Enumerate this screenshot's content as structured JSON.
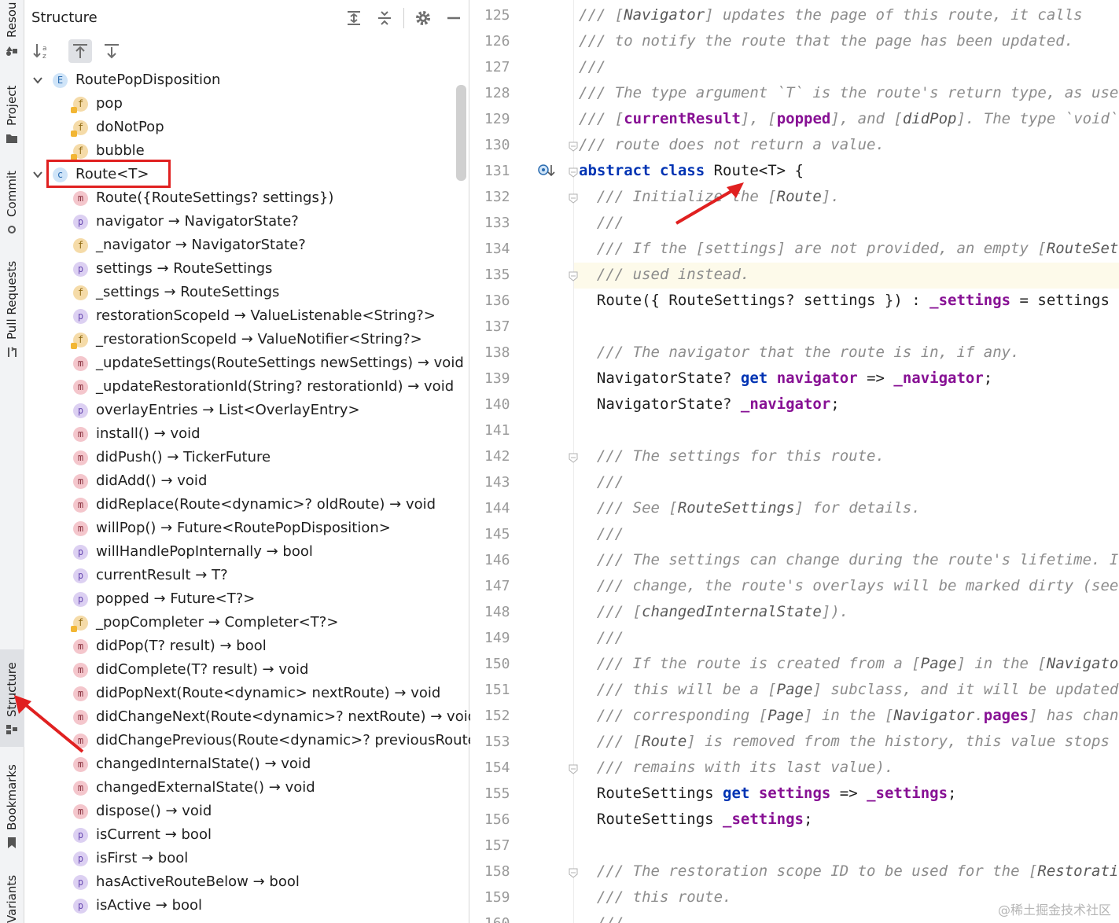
{
  "left_strip": {
    "tabs": [
      {
        "label": "Resou",
        "icon": "resource-manager-icon"
      },
      {
        "label": "Project",
        "icon": "folder-icon"
      },
      {
        "label": "Commit",
        "icon": "commit-icon"
      },
      {
        "label": "Pull Requests",
        "icon": "pull-request-icon"
      },
      {
        "label": "Structure",
        "icon": "structure-icon",
        "active": true
      },
      {
        "label": "Bookmarks",
        "icon": "bookmark-icon"
      },
      {
        "label": "Variants",
        "icon": "variants-icon"
      }
    ]
  },
  "structure": {
    "title": "Structure",
    "header_icons": [
      "expand-all-icon",
      "collapse-all-icon",
      "gear-icon",
      "minimize-icon"
    ],
    "toolbar_icons": [
      "sort-alpha-icon",
      "navigate-to-source-icon",
      "navigate-from-source-icon"
    ],
    "tree": [
      {
        "indent": 0,
        "expanded": true,
        "kind": "E",
        "label": "RoutePopDisposition"
      },
      {
        "indent": 1,
        "kind": "f",
        "lock": true,
        "label": "pop"
      },
      {
        "indent": 1,
        "kind": "f",
        "lock": true,
        "label": "doNotPop"
      },
      {
        "indent": 1,
        "kind": "f",
        "lock": true,
        "label": "bubble"
      },
      {
        "indent": 0,
        "expanded": true,
        "kind": "C",
        "label": "Route<T>"
      },
      {
        "indent": 1,
        "kind": "m",
        "label": "Route({RouteSettings? settings})"
      },
      {
        "indent": 1,
        "kind": "p",
        "label": "navigator → NavigatorState?"
      },
      {
        "indent": 1,
        "kind": "f",
        "label": "_navigator → NavigatorState?"
      },
      {
        "indent": 1,
        "kind": "p",
        "label": "settings → RouteSettings"
      },
      {
        "indent": 1,
        "kind": "f",
        "label": "_settings → RouteSettings"
      },
      {
        "indent": 1,
        "kind": "p",
        "label": "restorationScopeId → ValueListenable<String?>"
      },
      {
        "indent": 1,
        "kind": "f",
        "lock": true,
        "label": "_restorationScopeId → ValueNotifier<String?>"
      },
      {
        "indent": 1,
        "kind": "m",
        "label": "_updateSettings(RouteSettings newSettings) → void"
      },
      {
        "indent": 1,
        "kind": "m",
        "label": "_updateRestorationId(String? restorationId) → void"
      },
      {
        "indent": 1,
        "kind": "p",
        "label": "overlayEntries → List<OverlayEntry>"
      },
      {
        "indent": 1,
        "kind": "m",
        "label": "install() → void"
      },
      {
        "indent": 1,
        "kind": "m",
        "label": "didPush() → TickerFuture"
      },
      {
        "indent": 1,
        "kind": "m",
        "label": "didAdd() → void"
      },
      {
        "indent": 1,
        "kind": "m",
        "label": "didReplace(Route<dynamic>? oldRoute) → void"
      },
      {
        "indent": 1,
        "kind": "m",
        "label": "willPop() → Future<RoutePopDisposition>"
      },
      {
        "indent": 1,
        "kind": "p",
        "label": "willHandlePopInternally → bool"
      },
      {
        "indent": 1,
        "kind": "p",
        "label": "currentResult → T?"
      },
      {
        "indent": 1,
        "kind": "p",
        "label": "popped → Future<T?>"
      },
      {
        "indent": 1,
        "kind": "f",
        "lock": true,
        "label": "_popCompleter → Completer<T?>"
      },
      {
        "indent": 1,
        "kind": "m",
        "label": "didPop(T? result) → bool"
      },
      {
        "indent": 1,
        "kind": "m",
        "label": "didComplete(T? result) → void"
      },
      {
        "indent": 1,
        "kind": "m",
        "label": "didPopNext(Route<dynamic> nextRoute) → void"
      },
      {
        "indent": 1,
        "kind": "m",
        "label": "didChangeNext(Route<dynamic>? nextRoute) → void"
      },
      {
        "indent": 1,
        "kind": "m",
        "label": "didChangePrevious(Route<dynamic>? previousRoute) → void"
      },
      {
        "indent": 1,
        "kind": "m",
        "label": "changedInternalState() → void"
      },
      {
        "indent": 1,
        "kind": "m",
        "label": "changedExternalState() → void"
      },
      {
        "indent": 1,
        "kind": "m",
        "label": "dispose() → void"
      },
      {
        "indent": 1,
        "kind": "p",
        "label": "isCurrent → bool"
      },
      {
        "indent": 1,
        "kind": "p",
        "label": "isFirst → bool"
      },
      {
        "indent": 1,
        "kind": "p",
        "label": "hasActiveRouteBelow → bool"
      },
      {
        "indent": 1,
        "kind": "p",
        "label": "isActive → bool"
      }
    ]
  },
  "editor": {
    "current_line": 135,
    "lines": [
      {
        "n": "125",
        "fold": false,
        "tokens": [
          [
            "cm",
            "/// ["
          ],
          [
            "ref",
            "Navigator"
          ],
          [
            "cm",
            "] updates the page of this route, it calls"
          ]
        ]
      },
      {
        "n": "126",
        "tokens": [
          [
            "cm",
            "/// to notify the route that the page has been updated."
          ]
        ]
      },
      {
        "n": "127",
        "tokens": [
          [
            "cm",
            "///"
          ]
        ]
      },
      {
        "n": "128",
        "tokens": [
          [
            "cm",
            "/// The type argument `T` is the route's return type, as used by"
          ]
        ]
      },
      {
        "n": "129",
        "tokens": [
          [
            "cm",
            "/// ["
          ],
          [
            "fld",
            "currentResult"
          ],
          [
            "cm",
            "], ["
          ],
          [
            "fld",
            "popped"
          ],
          [
            "cm",
            "], and ["
          ],
          [
            "ref",
            "didPop"
          ],
          [
            "cm",
            "]. The type `void` may be used if the"
          ]
        ]
      },
      {
        "n": "130",
        "fold": true,
        "tokens": [
          [
            "cm",
            "/// route does not return a value."
          ]
        ]
      },
      {
        "n": "131",
        "fold": true,
        "marker": true,
        "tokens": [
          [
            "kw",
            "abstract"
          ],
          [
            "pl",
            " "
          ],
          [
            "kw",
            "class"
          ],
          [
            "pl",
            " Route<T> {"
          ]
        ]
      },
      {
        "n": "132",
        "fold": true,
        "tokens": [
          [
            "pl",
            "  "
          ],
          [
            "cm",
            "/// Initialize the ["
          ],
          [
            "ref",
            "Route"
          ],
          [
            "cm",
            "]."
          ]
        ]
      },
      {
        "n": "133",
        "tokens": [
          [
            "pl",
            "  "
          ],
          [
            "cm",
            "///"
          ]
        ]
      },
      {
        "n": "134",
        "tokens": [
          [
            "pl",
            "  "
          ],
          [
            "cm",
            "/// If the [settings] are not provided, an empty ["
          ],
          [
            "ref",
            "RouteSettings"
          ],
          [
            "cm",
            "] object is"
          ]
        ]
      },
      {
        "n": "135",
        "fold": true,
        "tokens": [
          [
            "pl",
            "  "
          ],
          [
            "cm",
            "/// used instead."
          ]
        ]
      },
      {
        "n": "136",
        "tokens": [
          [
            "pl",
            "  Route({ RouteSettings? settings }) : "
          ],
          [
            "fld",
            "_settings"
          ],
          [
            "pl",
            " = settings ?? const RouteSettings();"
          ]
        ]
      },
      {
        "n": "137",
        "tokens": []
      },
      {
        "n": "138",
        "tokens": [
          [
            "pl",
            "  "
          ],
          [
            "cm",
            "/// The navigator that the route is in, if any."
          ]
        ]
      },
      {
        "n": "139",
        "tokens": [
          [
            "pl",
            "  NavigatorState? "
          ],
          [
            "kw",
            "get"
          ],
          [
            "pl",
            " "
          ],
          [
            "fld",
            "navigator"
          ],
          [
            "pl",
            " => "
          ],
          [
            "fld",
            "_navigator"
          ],
          [
            "pl",
            ";"
          ]
        ]
      },
      {
        "n": "140",
        "tokens": [
          [
            "pl",
            "  NavigatorState? "
          ],
          [
            "fld",
            "_navigator"
          ],
          [
            "pl",
            ";"
          ]
        ]
      },
      {
        "n": "141",
        "tokens": []
      },
      {
        "n": "142",
        "fold": true,
        "tokens": [
          [
            "pl",
            "  "
          ],
          [
            "cm",
            "/// The settings for this route."
          ]
        ]
      },
      {
        "n": "143",
        "tokens": [
          [
            "pl",
            "  "
          ],
          [
            "cm",
            "///"
          ]
        ]
      },
      {
        "n": "144",
        "tokens": [
          [
            "pl",
            "  "
          ],
          [
            "cm",
            "/// See ["
          ],
          [
            "ref",
            "RouteSettings"
          ],
          [
            "cm",
            "] for details."
          ]
        ]
      },
      {
        "n": "145",
        "tokens": [
          [
            "pl",
            "  "
          ],
          [
            "cm",
            "///"
          ]
        ]
      },
      {
        "n": "146",
        "tokens": [
          [
            "pl",
            "  "
          ],
          [
            "cm",
            "/// The settings can change during the route's lifetime. If the settings"
          ]
        ]
      },
      {
        "n": "147",
        "tokens": [
          [
            "pl",
            "  "
          ],
          [
            "cm",
            "/// change, the route's overlays will be marked dirty (see"
          ]
        ]
      },
      {
        "n": "148",
        "tokens": [
          [
            "pl",
            "  "
          ],
          [
            "cm",
            "/// ["
          ],
          [
            "ref",
            "changedInternalState"
          ],
          [
            "cm",
            "])."
          ]
        ]
      },
      {
        "n": "149",
        "tokens": [
          [
            "pl",
            "  "
          ],
          [
            "cm",
            "///"
          ]
        ]
      },
      {
        "n": "150",
        "tokens": [
          [
            "pl",
            "  "
          ],
          [
            "cm",
            "/// If the route is created from a ["
          ],
          [
            "ref",
            "Page"
          ],
          [
            "cm",
            "] in the ["
          ],
          [
            "ref",
            "Navigator.pages"
          ],
          [
            "cm",
            "] list, then"
          ]
        ]
      },
      {
        "n": "151",
        "tokens": [
          [
            "pl",
            "  "
          ],
          [
            "cm",
            "/// this will be a ["
          ],
          [
            "ref",
            "Page"
          ],
          [
            "cm",
            "] subclass, and it will be updated each time its"
          ]
        ]
      },
      {
        "n": "152",
        "tokens": [
          [
            "pl",
            "  "
          ],
          [
            "cm",
            "/// corresponding ["
          ],
          [
            "ref",
            "Page"
          ],
          [
            "cm",
            "] in the ["
          ],
          [
            "ref",
            "Navigator"
          ],
          [
            "cm",
            "."
          ],
          [
            "fld",
            "pages"
          ],
          [
            "cm",
            "] has changed. Once the"
          ]
        ]
      },
      {
        "n": "153",
        "tokens": [
          [
            "pl",
            "  "
          ],
          [
            "cm",
            "/// ["
          ],
          [
            "ref",
            "Route"
          ],
          [
            "cm",
            "] is removed from the history, this value stops updating (and"
          ]
        ]
      },
      {
        "n": "154",
        "fold": true,
        "tokens": [
          [
            "pl",
            "  "
          ],
          [
            "cm",
            "/// remains with its last value)."
          ]
        ]
      },
      {
        "n": "155",
        "tokens": [
          [
            "pl",
            "  RouteSettings "
          ],
          [
            "kw",
            "get"
          ],
          [
            "pl",
            " "
          ],
          [
            "fld",
            "settings"
          ],
          [
            "pl",
            " => "
          ],
          [
            "fld",
            "_settings"
          ],
          [
            "pl",
            ";"
          ]
        ]
      },
      {
        "n": "156",
        "tokens": [
          [
            "pl",
            "  RouteSettings "
          ],
          [
            "fld",
            "_settings"
          ],
          [
            "pl",
            ";"
          ]
        ]
      },
      {
        "n": "157",
        "tokens": []
      },
      {
        "n": "158",
        "fold": true,
        "tokens": [
          [
            "pl",
            "  "
          ],
          [
            "cm",
            "/// The restoration scope ID to be used for the ["
          ],
          [
            "ref",
            "RestorationScope"
          ],
          [
            "cm",
            "] surrounding"
          ]
        ]
      },
      {
        "n": "159",
        "tokens": [
          [
            "pl",
            "  "
          ],
          [
            "cm",
            "/// this route."
          ]
        ]
      },
      {
        "n": "160",
        "tokens": [
          [
            "pl",
            "  "
          ],
          [
            "cm",
            "///"
          ]
        ]
      }
    ]
  },
  "watermark": "@稀土掘金技术社区",
  "colors": {
    "annotation_red": "#e02020",
    "keyword": "#0033b3",
    "field": "#871094",
    "comment": "#8c8c8c"
  }
}
